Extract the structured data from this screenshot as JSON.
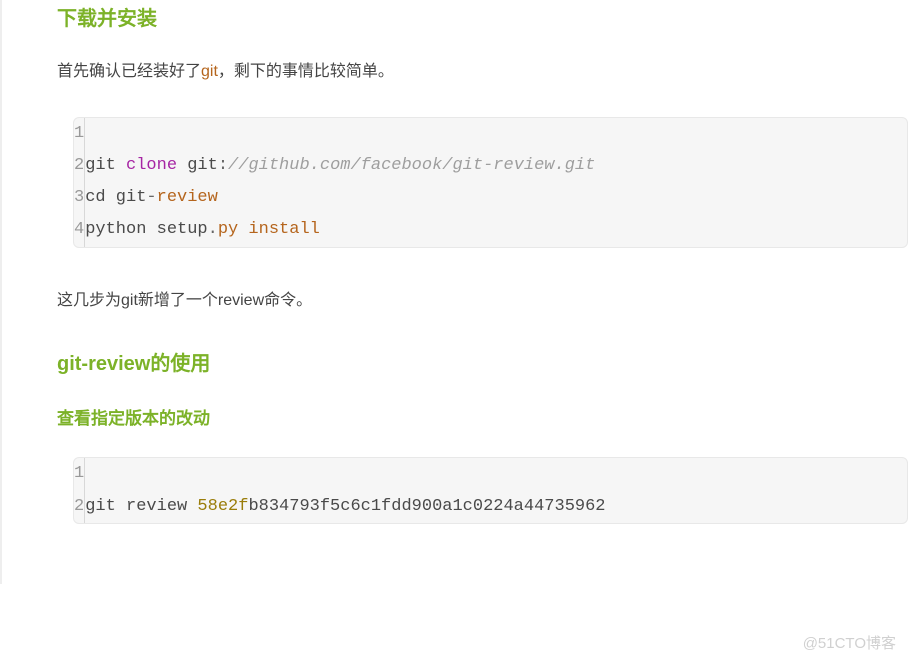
{
  "article": {
    "section1": {
      "heading": "下载并安装",
      "para_before_text": "首先确认已经装好了",
      "para_link": "git",
      "para_after_text": "，剩下的事情比较简单。"
    },
    "code1": {
      "lines": [
        {
          "n": "1",
          "tokens": []
        },
        {
          "n": "2",
          "tokens": [
            {
              "t": "git ",
              "c": ""
            },
            {
              "t": "clone",
              "c": "tok-fn"
            },
            {
              "t": " git",
              "c": ""
            },
            {
              "t": ":",
              "c": "tok-op"
            },
            {
              "t": "//github.com/facebook/git-review.git",
              "c": "tok-cm"
            }
          ]
        },
        {
          "n": "3",
          "tokens": [
            {
              "t": "cd git",
              "c": ""
            },
            {
              "t": "-",
              "c": "tok-op"
            },
            {
              "t": "review",
              "c": "tok-kw"
            }
          ]
        },
        {
          "n": "4",
          "tokens": [
            {
              "t": "python setup",
              "c": ""
            },
            {
              "t": ".",
              "c": "tok-op"
            },
            {
              "t": "py install",
              "c": "tok-kw"
            }
          ]
        }
      ],
      "after_para": "这几步为git新增了一个review命令。"
    },
    "section2": {
      "heading": "git-review的使用",
      "subheading": "查看指定版本的改动"
    },
    "code2": {
      "lines": [
        {
          "n": "1",
          "tokens": []
        },
        {
          "n": "2",
          "tokens": [
            {
              "t": "git review ",
              "c": ""
            },
            {
              "t": "58e2f",
              "c": "tok-hash"
            },
            {
              "t": "b834793f5c6c1fdd900a1c0224a44735962",
              "c": ""
            }
          ]
        }
      ]
    },
    "watermark": "@51CTO博客"
  }
}
